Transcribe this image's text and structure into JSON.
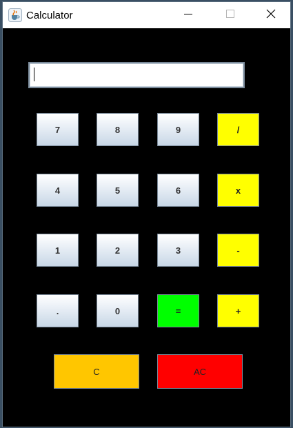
{
  "window": {
    "title": "Calculator"
  },
  "display": {
    "value": ""
  },
  "keypad": {
    "rows": [
      [
        {
          "label": "7",
          "kind": "num",
          "name": "key-7-button"
        },
        {
          "label": "8",
          "kind": "num",
          "name": "key-8-button"
        },
        {
          "label": "9",
          "kind": "num",
          "name": "key-9-button"
        },
        {
          "label": "/",
          "kind": "op",
          "name": "divide-button"
        }
      ],
      [
        {
          "label": "4",
          "kind": "num",
          "name": "key-4-button"
        },
        {
          "label": "5",
          "kind": "num",
          "name": "key-5-button"
        },
        {
          "label": "6",
          "kind": "num",
          "name": "key-6-button"
        },
        {
          "label": "x",
          "kind": "op",
          "name": "multiply-button"
        }
      ],
      [
        {
          "label": "1",
          "kind": "num",
          "name": "key-1-button"
        },
        {
          "label": "2",
          "kind": "num",
          "name": "key-2-button"
        },
        {
          "label": "3",
          "kind": "num",
          "name": "key-3-button"
        },
        {
          "label": "-",
          "kind": "op",
          "name": "subtract-button"
        }
      ],
      [
        {
          "label": ".",
          "kind": "num",
          "name": "decimal-button"
        },
        {
          "label": "0",
          "kind": "num",
          "name": "key-0-button"
        },
        {
          "label": "=",
          "kind": "eq",
          "name": "equals-button"
        },
        {
          "label": "+",
          "kind": "op",
          "name": "add-button"
        }
      ]
    ],
    "clear_label": "C",
    "all_clear_label": "AC"
  },
  "colors": {
    "background": "#000000",
    "operator": "#ffff00",
    "equals": "#00ff00",
    "clear": "#ffc600",
    "all_clear": "#ff0000"
  },
  "icons": {
    "app": "java-cup-icon",
    "minimize": "minimize-icon",
    "maximize": "maximize-icon",
    "close": "close-icon"
  }
}
